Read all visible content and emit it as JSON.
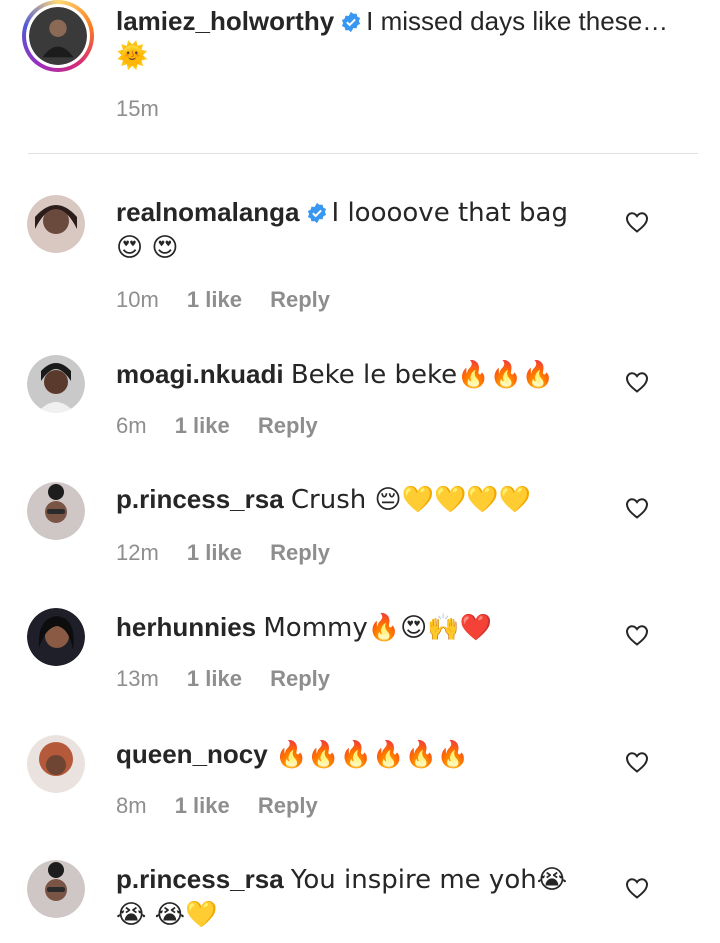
{
  "caption": {
    "username": "lamiez_holworthy",
    "verified": true,
    "text": "I missed days like these… 🌞",
    "time": "15m"
  },
  "comments": [
    {
      "username": "realnomalanga",
      "verified": true,
      "text": "I loooove that bag 😍 😍",
      "time": "10m",
      "likes": "1 like",
      "reply": "Reply"
    },
    {
      "username": "moagi.nkuadi",
      "verified": false,
      "text": "Beke le beke🔥🔥🔥",
      "time": "6m",
      "likes": "1 like",
      "reply": "Reply"
    },
    {
      "username": "p.rincess_rsa",
      "verified": false,
      "text": "Crush 😔💛💛💛💛",
      "time": "12m",
      "likes": "1 like",
      "reply": "Reply"
    },
    {
      "username": "herhunnies",
      "verified": false,
      "text": "Mommy🔥😍🙌❤️",
      "time": "13m",
      "likes": "1 like",
      "reply": "Reply"
    },
    {
      "username": "queen_nocy",
      "verified": false,
      "text": "🔥🔥🔥🔥🔥🔥",
      "time": "8m",
      "likes": "1 like",
      "reply": "Reply"
    },
    {
      "username": "p.rincess_rsa",
      "verified": false,
      "text": "You inspire me yoh😭😭 😭💛",
      "time": "",
      "likes": "",
      "reply": ""
    }
  ],
  "colors": {
    "verified_blue": "#3897f0",
    "meta_gray": "#8e8e8e",
    "text": "#262626"
  },
  "icons": {
    "verified": "verified-badge-icon",
    "like": "heart-outline-icon"
  }
}
